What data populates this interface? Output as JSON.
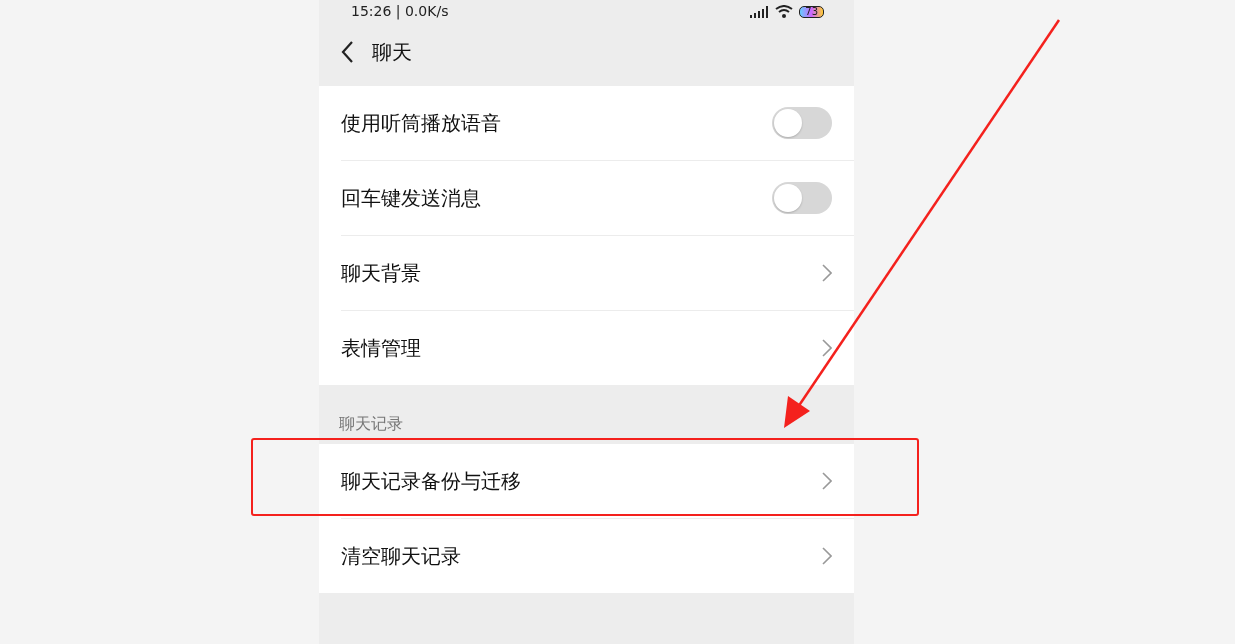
{
  "status_bar": {
    "time": "15:26 | 0.0K/s",
    "battery": "73"
  },
  "header": {
    "title": "聊天"
  },
  "groups": [
    {
      "items": [
        {
          "kind": "toggle",
          "label": "使用听筒播放语音",
          "on": false
        },
        {
          "kind": "toggle",
          "label": "回车键发送消息",
          "on": false
        },
        {
          "kind": "link",
          "label": "聊天背景"
        },
        {
          "kind": "link",
          "label": "表情管理"
        }
      ]
    },
    {
      "label": "聊天记录",
      "items": [
        {
          "kind": "link",
          "label": "聊天记录备份与迁移"
        },
        {
          "kind": "link",
          "label": "清空聊天记录"
        }
      ]
    }
  ]
}
